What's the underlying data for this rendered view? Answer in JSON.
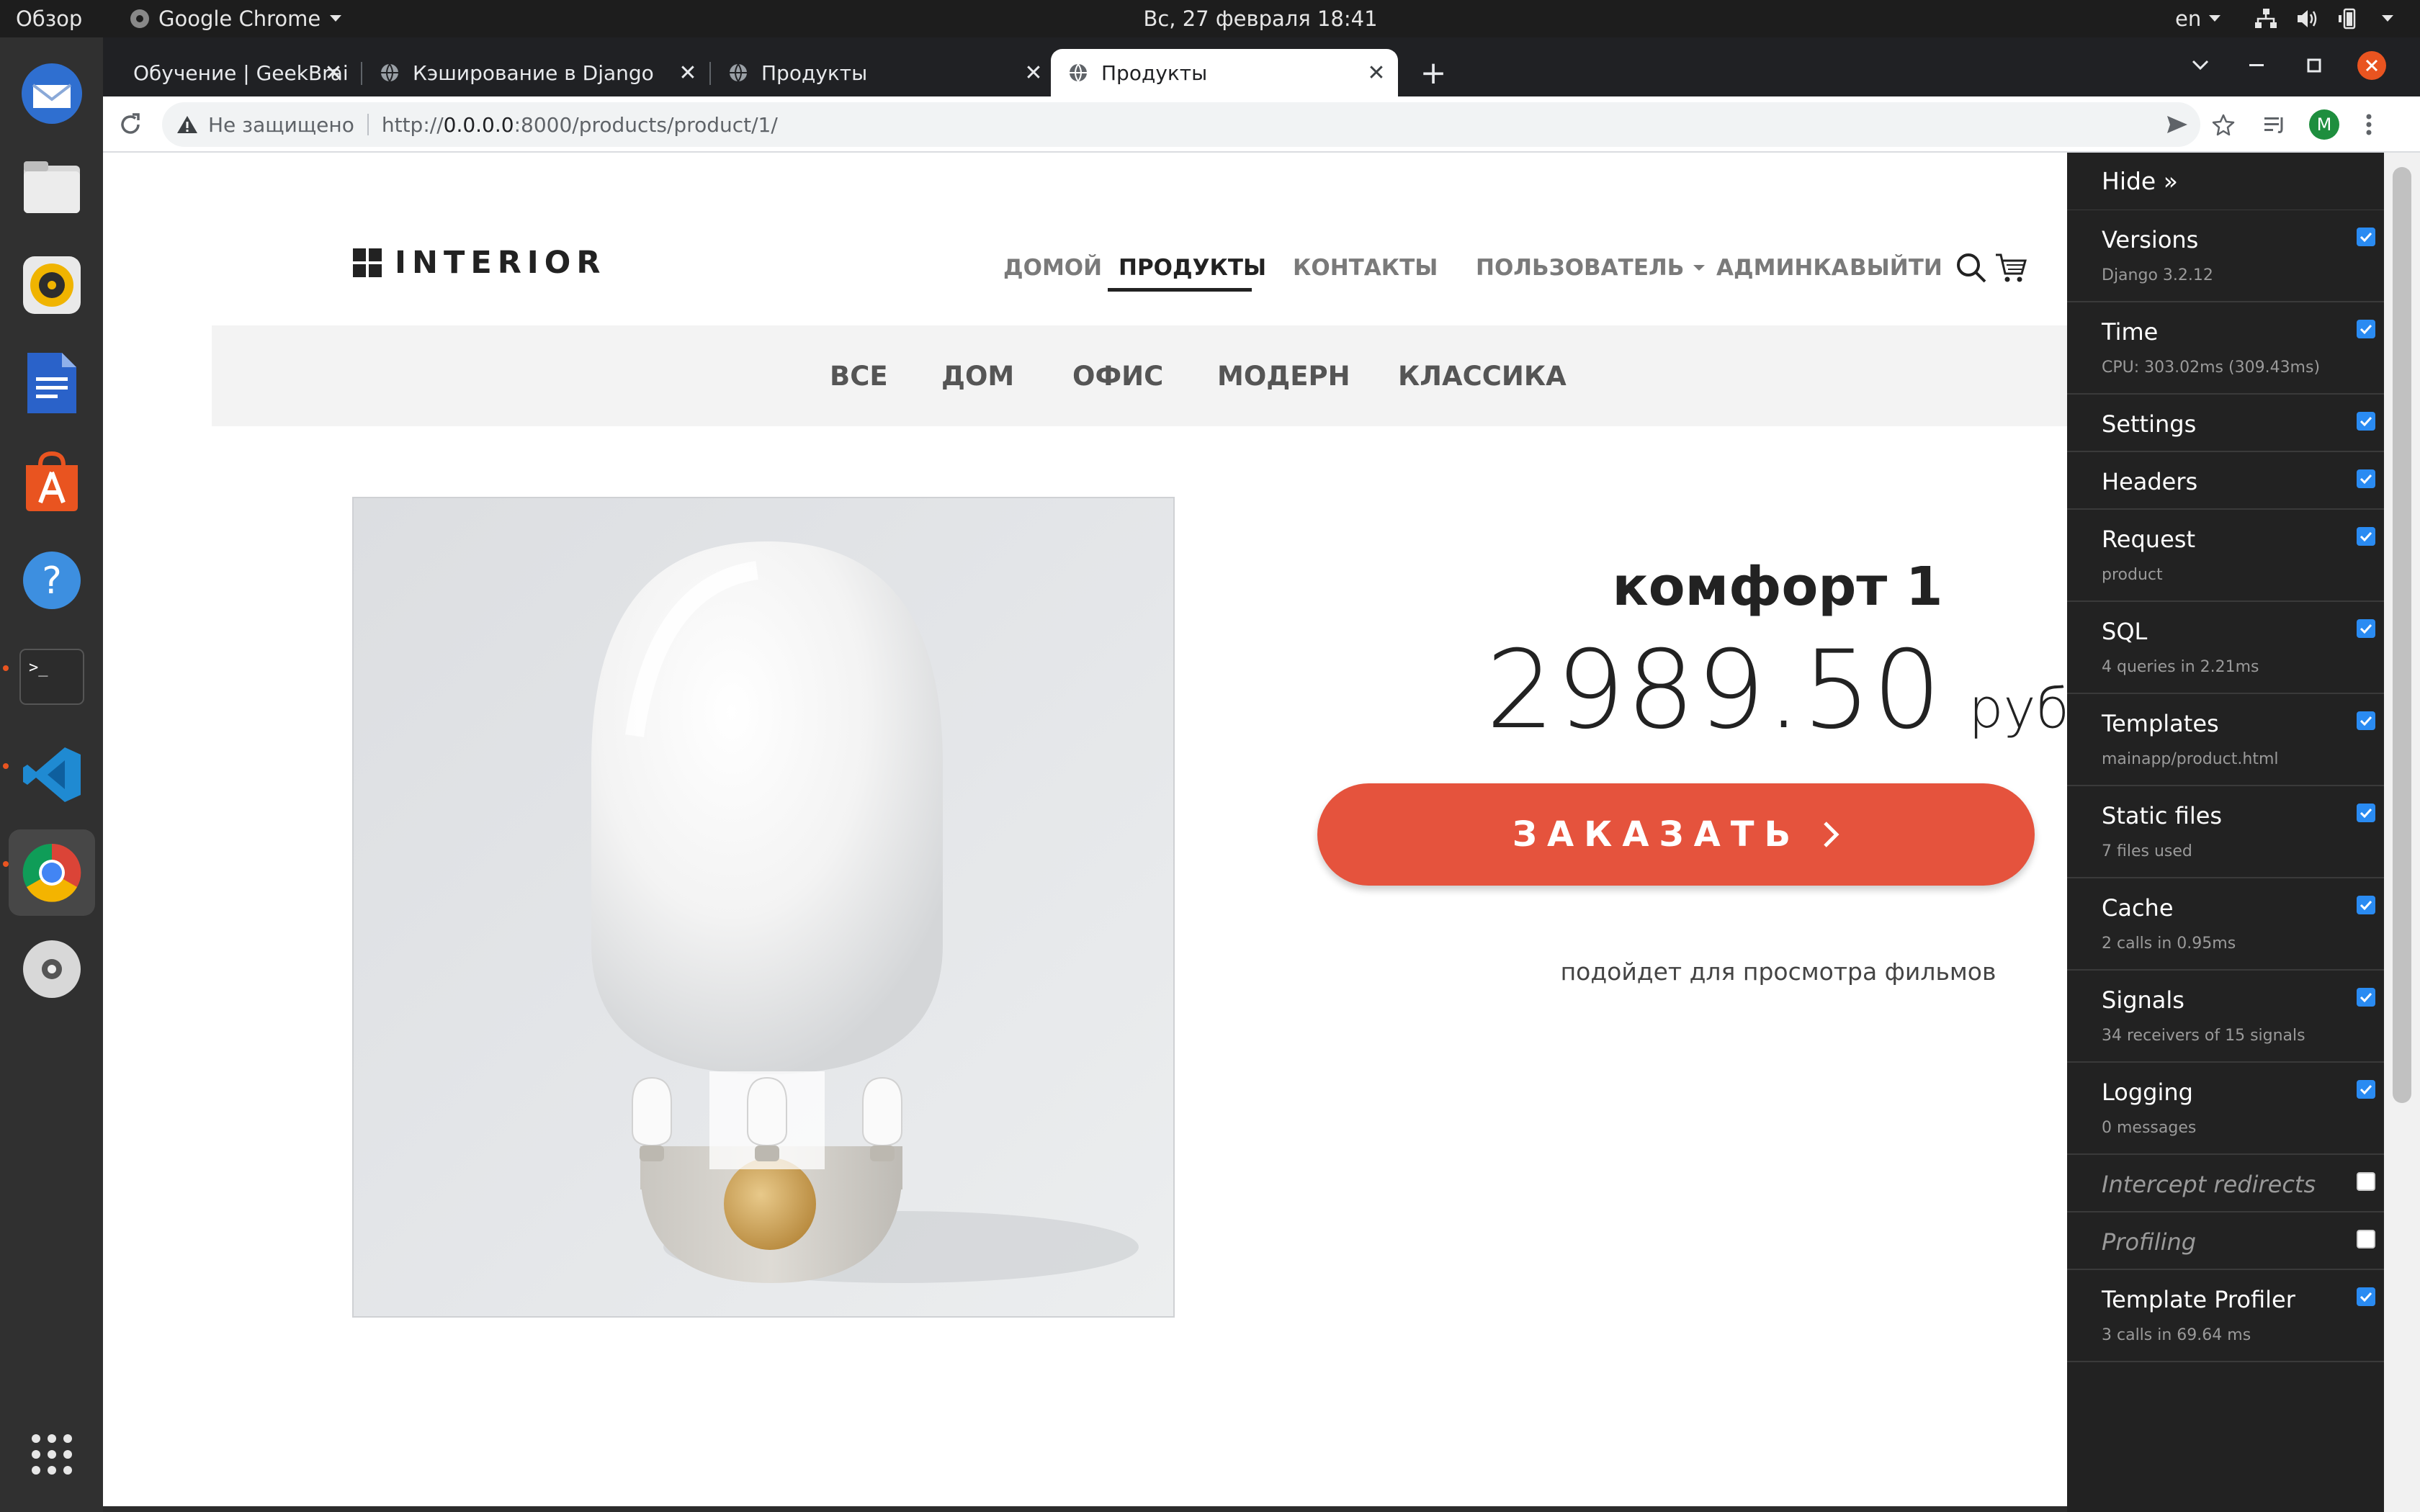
{
  "ubuntu_bar": {
    "overview": "Обзор",
    "app_name": "Google Chrome",
    "clock": "Вс, 27 февраля  18:41",
    "lang": "en"
  },
  "dock": {
    "items": [
      "mail",
      "files",
      "rhythmbox",
      "writer",
      "software",
      "help",
      "terminal",
      "vscode",
      "chrome",
      "dvd",
      "apps"
    ]
  },
  "chrome": {
    "tabs": [
      {
        "title": "Обучение | GeekBrains - с"
      },
      {
        "title": "Кэширование в Django"
      },
      {
        "title": "Продукты"
      },
      {
        "title": "Продукты"
      }
    ],
    "close_glyph": "✕",
    "new_tab_glyph": "+",
    "security_label": "Не защищено",
    "url_prefix": "http://",
    "url_host": "0.0.0.0",
    "url_rest": ":8000/products/product/1/",
    "profile_initial": "M"
  },
  "site": {
    "logo_text": "INTERIOR",
    "nav": [
      {
        "label": "ДОМОЙ"
      },
      {
        "label": "ПРОДУКТЫ"
      },
      {
        "label": "КОНТАКТЫ"
      },
      {
        "label": "ПОЛЬЗОВАТЕЛЬ"
      },
      {
        "label": "АДМИНКА"
      },
      {
        "label": "ВЫЙТИ"
      }
    ],
    "categories": [
      "ВСЕ",
      "ДОМ",
      "ОФИС",
      "МОДЕРН",
      "КЛАССИКА"
    ],
    "product": {
      "title": "комфорт 1",
      "price": "2989.50",
      "currency": "руб",
      "order_label": "ЗАКАЗАТЬ",
      "description": "подойдет для просмотра фильмов"
    }
  },
  "debug_toolbar": {
    "hide_label": "Hide »",
    "panels": [
      {
        "title": "Versions",
        "sub": "Django 3.2.12",
        "checked": true
      },
      {
        "title": "Time",
        "sub": "CPU: 303.02ms (309.43ms)",
        "checked": true
      },
      {
        "title": "Settings",
        "sub": "",
        "checked": true
      },
      {
        "title": "Headers",
        "sub": "",
        "checked": true
      },
      {
        "title": "Request",
        "sub": "product",
        "checked": true
      },
      {
        "title": "SQL",
        "sub": "4 queries in 2.21ms",
        "checked": true
      },
      {
        "title": "Templates",
        "sub": "mainapp/product.html",
        "checked": true
      },
      {
        "title": "Static files",
        "sub": "7 files used",
        "checked": true
      },
      {
        "title": "Cache",
        "sub": "2 calls in 0.95ms",
        "checked": true
      },
      {
        "title": "Signals",
        "sub": "34 receivers of 15 signals",
        "checked": true
      },
      {
        "title": "Logging",
        "sub": "0 messages",
        "checked": true
      },
      {
        "title": "Intercept redirects",
        "sub": "",
        "checked": false
      },
      {
        "title": "Profiling",
        "sub": "",
        "checked": false
      },
      {
        "title": "Template Profiler",
        "sub": "3 calls in 69.64 ms",
        "checked": true
      }
    ]
  },
  "colors": {
    "accent_button": "#e5533d",
    "debug_bg": "#222222",
    "checkbox": "#2a8bf2"
  }
}
